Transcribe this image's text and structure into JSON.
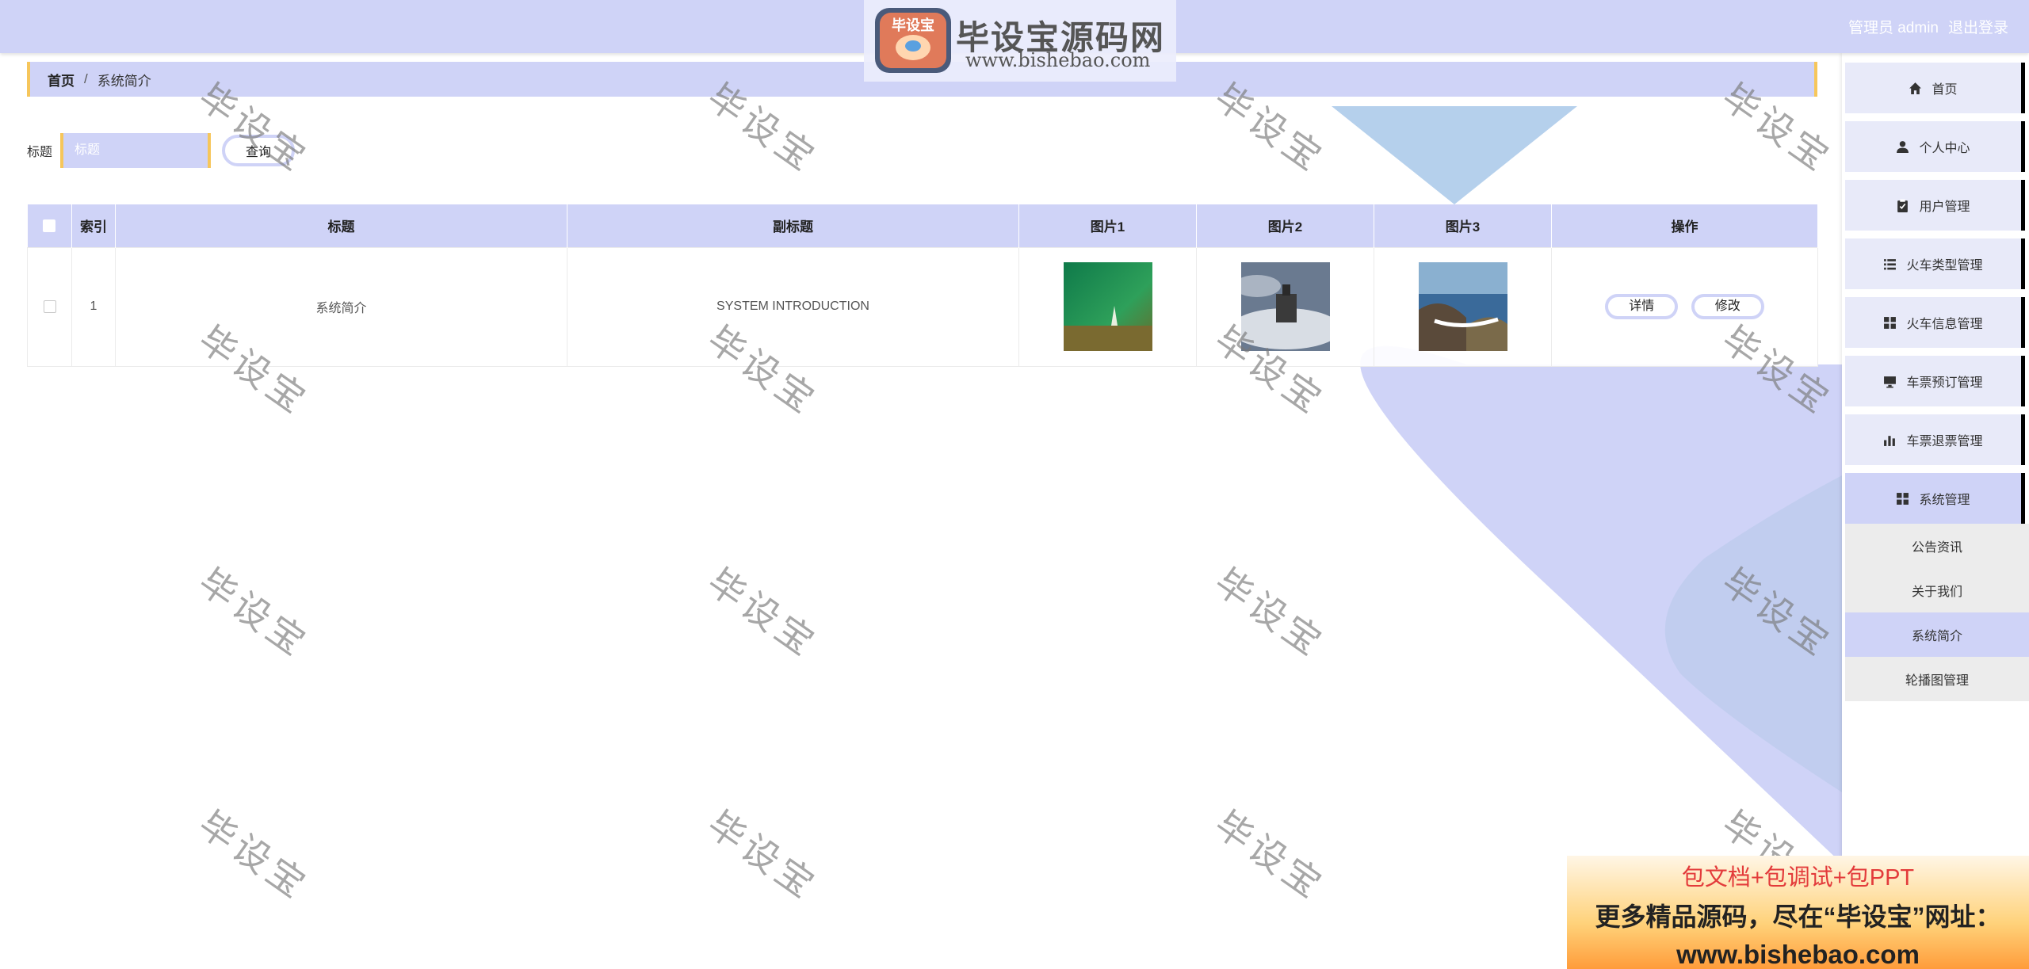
{
  "header": {
    "user_label": "管理员 admin",
    "logout_label": "退出登录"
  },
  "logo": {
    "badge_text": "毕设宝",
    "title": "毕设宝源码网",
    "url": "www.bishebao.com"
  },
  "breadcrumb": {
    "home": "首页",
    "separator": "/",
    "current": "系统简介"
  },
  "search": {
    "label": "标题",
    "placeholder": "标题",
    "value": "",
    "button_label": "查询"
  },
  "table": {
    "columns": [
      "索引",
      "标题",
      "副标题",
      "图片1",
      "图片2",
      "图片3",
      "操作"
    ],
    "rows": [
      {
        "index": "1",
        "title": "系统简介",
        "subtitle": "SYSTEM INTRODUCTION",
        "image1": "green-nature-thumbnail",
        "image2": "castle-in-clouds-thumbnail",
        "image3": "coastal-rocks-thumbnail",
        "detail_label": "详情",
        "edit_label": "修改"
      }
    ]
  },
  "sidebar": {
    "items": [
      {
        "label": "首页",
        "icon": "home-icon"
      },
      {
        "label": "个人中心",
        "icon": "user-icon"
      },
      {
        "label": "用户管理",
        "icon": "clipboard-icon"
      },
      {
        "label": "火车类型管理",
        "icon": "list-icon"
      },
      {
        "label": "火车信息管理",
        "icon": "grid-icon"
      },
      {
        "label": "车票预订管理",
        "icon": "monitor-icon"
      },
      {
        "label": "车票退票管理",
        "icon": "bar-chart-icon"
      },
      {
        "label": "系统管理",
        "icon": "grid-icon"
      }
    ],
    "sub_items": [
      {
        "label": "公告资讯"
      },
      {
        "label": "关于我们"
      },
      {
        "label": "系统简介",
        "active": true
      },
      {
        "label": "轮播图管理"
      }
    ]
  },
  "watermark": "毕设宝",
  "promo": {
    "line1": "包文档+包调试+包PPT",
    "line2": "更多精品源码，尽在“毕设宝”网址：",
    "line3": "www.bishebao.com"
  },
  "colors": {
    "accent": "#cfd3f7",
    "border_accent": "#f6c65b",
    "sidebar_bg": "#e8eaf9"
  }
}
